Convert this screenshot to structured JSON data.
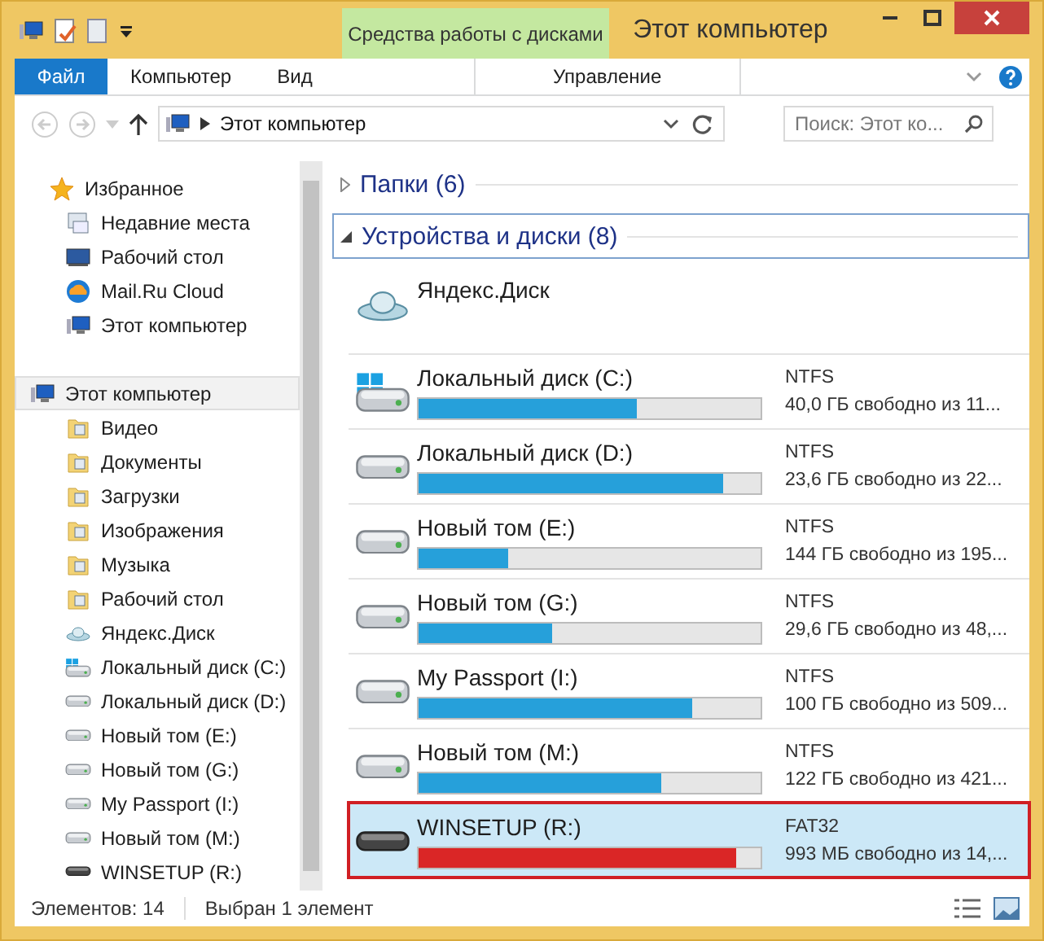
{
  "window": {
    "title": "Этот компьютер"
  },
  "ribbon": {
    "context_group": "Средства работы с дисками",
    "tabs": [
      {
        "label": "Файл",
        "kind": "file"
      },
      {
        "label": "Компьютер",
        "kind": "normal"
      },
      {
        "label": "Вид",
        "kind": "normal"
      },
      {
        "label": "Управление",
        "kind": "context"
      }
    ]
  },
  "address": {
    "path": "Этот компьютер",
    "search_placeholder": "Поиск: Этот ко..."
  },
  "nav": [
    {
      "label": "Избранное",
      "selected": false,
      "children": [
        {
          "label": "Недавние места"
        },
        {
          "label": "Рабочий стол"
        },
        {
          "label": "Mail.Ru Cloud"
        },
        {
          "label": "Этот компьютер"
        }
      ]
    },
    {
      "label": "Этот компьютер",
      "selected": true,
      "children": [
        {
          "label": "Видео"
        },
        {
          "label": "Документы"
        },
        {
          "label": "Загрузки"
        },
        {
          "label": "Изображения"
        },
        {
          "label": "Музыка"
        },
        {
          "label": "Рабочий стол"
        },
        {
          "label": "Яндекс.Диск"
        },
        {
          "label": "Локальный диск (C:)"
        },
        {
          "label": "Локальный диск (D:)"
        },
        {
          "label": "Новый том (E:)"
        },
        {
          "label": "Новый том (G:)"
        },
        {
          "label": "My Passport (I:)"
        },
        {
          "label": "Новый том (M:)"
        },
        {
          "label": "WINSETUP (R:)"
        }
      ]
    }
  ],
  "sections": [
    {
      "label": "Папки (6)",
      "expanded": false,
      "focused": false
    },
    {
      "label": "Устройства и диски (8)",
      "expanded": true,
      "focused": true
    }
  ],
  "devices": [
    {
      "kind": "cloud",
      "name": "Яндекс.Диск"
    },
    {
      "kind": "drive",
      "name": "Локальный диск (C:)",
      "filesystem": "NTFS",
      "free": "40,0 ГБ свободно из 11...",
      "level": 0.64,
      "critical": false,
      "selected": false,
      "outlined": false
    },
    {
      "kind": "drive",
      "name": "Локальный диск (D:)",
      "filesystem": "NTFS",
      "free": "23,6 ГБ свободно из 22...",
      "level": 0.89,
      "critical": false,
      "selected": false,
      "outlined": false
    },
    {
      "kind": "drive",
      "name": "Новый том (E:)",
      "filesystem": "NTFS",
      "free": "144 ГБ свободно из 195...",
      "level": 0.26,
      "critical": false,
      "selected": false,
      "outlined": false
    },
    {
      "kind": "drive",
      "name": "Новый том (G:)",
      "filesystem": "NTFS",
      "free": "29,6 ГБ свободно из 48,...",
      "level": 0.39,
      "critical": false,
      "selected": false,
      "outlined": false
    },
    {
      "kind": "drive",
      "name": "My Passport (I:)",
      "filesystem": "NTFS",
      "free": "100 ГБ свободно из 509...",
      "level": 0.8,
      "critical": false,
      "selected": false,
      "outlined": false
    },
    {
      "kind": "drive",
      "name": "Новый том (M:)",
      "filesystem": "NTFS",
      "free": "122 ГБ свободно из 421...",
      "level": 0.71,
      "critical": false,
      "selected": false,
      "outlined": false
    },
    {
      "kind": "drive",
      "name": "WINSETUP (R:)",
      "filesystem": "FAT32",
      "free": "993 МБ свободно из 14,...",
      "level": 0.93,
      "critical": true,
      "selected": true,
      "outlined": true
    }
  ],
  "status_bar": {
    "count": "Элементов: 14",
    "selection": "Выбран 1 элемент"
  }
}
